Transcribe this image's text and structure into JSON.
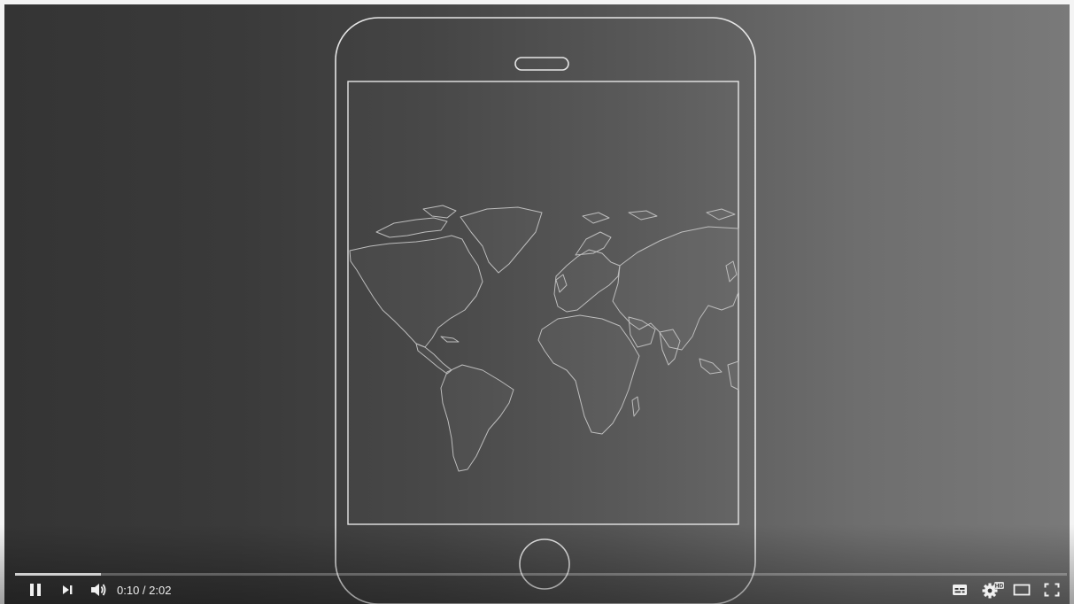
{
  "player": {
    "time_current": "0:10",
    "time_separator": " / ",
    "time_total": "2:02",
    "progress_fraction": 0.082
  },
  "controls": {
    "play_pause_icon": "pause-icon",
    "next_icon": "next-icon",
    "volume_icon": "volume-icon",
    "subtitles_icon": "subtitles-icon",
    "settings_icon": "settings-hd-icon",
    "settings_badge": "HD",
    "theater_icon": "theater-mode-icon",
    "fullscreen_icon": "fullscreen-icon"
  },
  "video": {
    "illustration": "tablet-outline-with-world-map"
  }
}
